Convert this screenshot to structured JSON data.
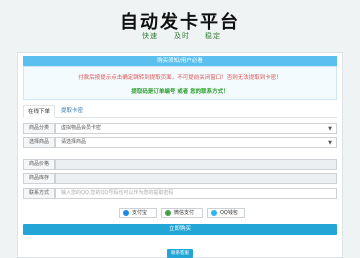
{
  "header": {
    "title": "自动发卡平台",
    "slogans": [
      "快速",
      "及时",
      "稳定"
    ]
  },
  "notice": {
    "bar_title": "购买须知/用户必看",
    "line1": "付款后按提示点击确定跳转到提取页面，不可提前关闭窗口！否则无法提取到卡密！",
    "line2": "提取码是订单编号 或者 您的联系方式！"
  },
  "tabs": [
    {
      "label": "在线下单",
      "active": true
    },
    {
      "label": "提取卡密",
      "active": false
    }
  ],
  "form": {
    "category": {
      "label": "商品分类",
      "value": "虚拟物品会员卡密"
    },
    "product": {
      "label": "选择商品",
      "value": "请选择商品"
    },
    "price": {
      "label": "商品价格",
      "value": ""
    },
    "stock": {
      "label": "商品库存",
      "value": ""
    },
    "contact": {
      "label": "联系方式",
      "placeholder": "输入您的QQ,您的QQ号码也可以作为您的提取密码"
    }
  },
  "payment": [
    {
      "label": "支付宝",
      "icon": "alipay-icon",
      "color": "#1e88e5"
    },
    {
      "label": "微信支付",
      "icon": "wechat-icon",
      "color": "#43a047"
    },
    {
      "label": "QQ钱包",
      "icon": "qq-wallet-icon",
      "color": "#29b6f6"
    }
  ],
  "buy_button": "立即购买",
  "query_button": "联系客服",
  "colors": {
    "accent": "#23a6d5",
    "notice_bar": "#5bc0ee",
    "warning": "#d9534f",
    "success": "#2e9e2e"
  }
}
